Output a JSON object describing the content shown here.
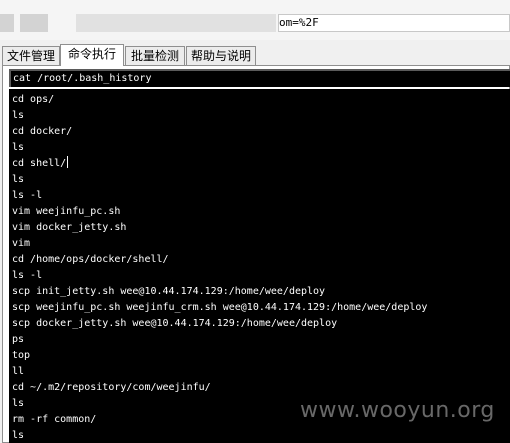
{
  "address_bar": {
    "url_text": "om=%2F"
  },
  "tabs": [
    {
      "label": "文件管理"
    },
    {
      "label": "命令执行"
    },
    {
      "label": "批量检测"
    },
    {
      "label": "帮助与说明"
    }
  ],
  "command": {
    "value": "cat /root/.bash_history"
  },
  "output_lines": [
    "cd ops/",
    "ls",
    "cd docker/",
    "ls",
    "cd shell/",
    "ls",
    "ls -l",
    "vim weejinfu_pc.sh",
    "vim docker_jetty.sh",
    "vim",
    "cd /home/ops/docker/shell/",
    "ls -l",
    "scp init_jetty.sh wee@10.44.174.129:/home/wee/deploy",
    "scp weejinfu_pc.sh weejinfu_crm.sh wee@10.44.174.129:/home/wee/deploy",
    "scp docker_jetty.sh wee@10.44.174.129:/home/wee/deploy",
    "ps",
    "top",
    "ll",
    "cd ~/.m2/repository/com/weejinfu/",
    "ls",
    "rm -rf common/",
    "ls"
  ],
  "watermark": "www.wooyun.org"
}
